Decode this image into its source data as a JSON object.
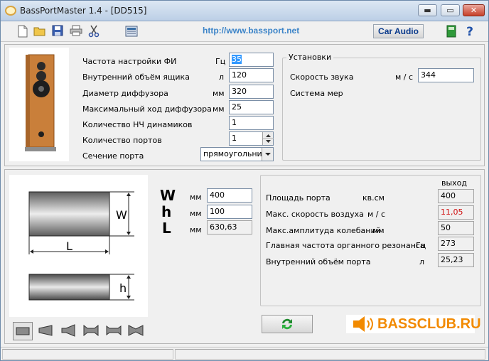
{
  "window": {
    "title": "BassPortMaster 1.4  -  [DD515]",
    "min_glyph": "▬",
    "max_glyph": "▭",
    "close_glyph": "✕"
  },
  "toolbar": {
    "url": "http://www.bassport.net",
    "car_audio_label": "Car Audio",
    "help_label": "?"
  },
  "params": {
    "rows": [
      {
        "label": "Частота настройки ФИ",
        "unit": "Гц",
        "value": "35"
      },
      {
        "label": "Внутренний объём ящика",
        "unit": "л",
        "value": "120"
      },
      {
        "label": "Диаметр диффузора",
        "unit": "мм",
        "value": "320"
      },
      {
        "label": "Максимальный ход диффузора",
        "unit": "мм",
        "value": "25"
      },
      {
        "label": "Количество НЧ динамиков",
        "unit": "",
        "value": "1"
      },
      {
        "label": "Количество портов",
        "unit": "",
        "value": "1"
      }
    ],
    "port_section_label": "Сечение порта",
    "port_section_value": "прямоугольник"
  },
  "settings": {
    "title": "Установки",
    "sound_speed_label": "Скорость звука",
    "sound_speed_unit": "м / с",
    "sound_speed_value": "344",
    "units_label": "Система мер"
  },
  "dimensions": {
    "rows": [
      {
        "letter": "W",
        "unit": "мм",
        "value": "400"
      },
      {
        "letter": "h",
        "unit": "мм",
        "value": "100"
      },
      {
        "letter": "L",
        "unit": "мм",
        "value": "630,63"
      }
    ],
    "diagram": {
      "w_label": "W",
      "l_label": "L",
      "h_label": "h"
    }
  },
  "output": {
    "header": "выход",
    "rows": [
      {
        "label": "Площадь порта",
        "unit": "кв.см",
        "value": "400",
        "color": "#000000"
      },
      {
        "label": "Макс. скорость воздуха",
        "unit": "м / с",
        "value": "11,05",
        "color": "#d01010"
      },
      {
        "label": "Макс.амплитуда колебаний",
        "unit": "мм",
        "value": "50",
        "color": "#000000"
      },
      {
        "label": "Главная частота органного резонанса",
        "unit": "Гц",
        "value": "273",
        "color": "#000000"
      },
      {
        "label": "Внутренний объём порта",
        "unit": "л",
        "value": "25,23",
        "color": "#000000"
      }
    ]
  },
  "brand": {
    "text": "BASSCLUB.RU",
    "color": "#f28a00"
  },
  "colors": {
    "accent": "#3c84c8",
    "selection": "#3399ff",
    "warning_value": "#d01010"
  }
}
